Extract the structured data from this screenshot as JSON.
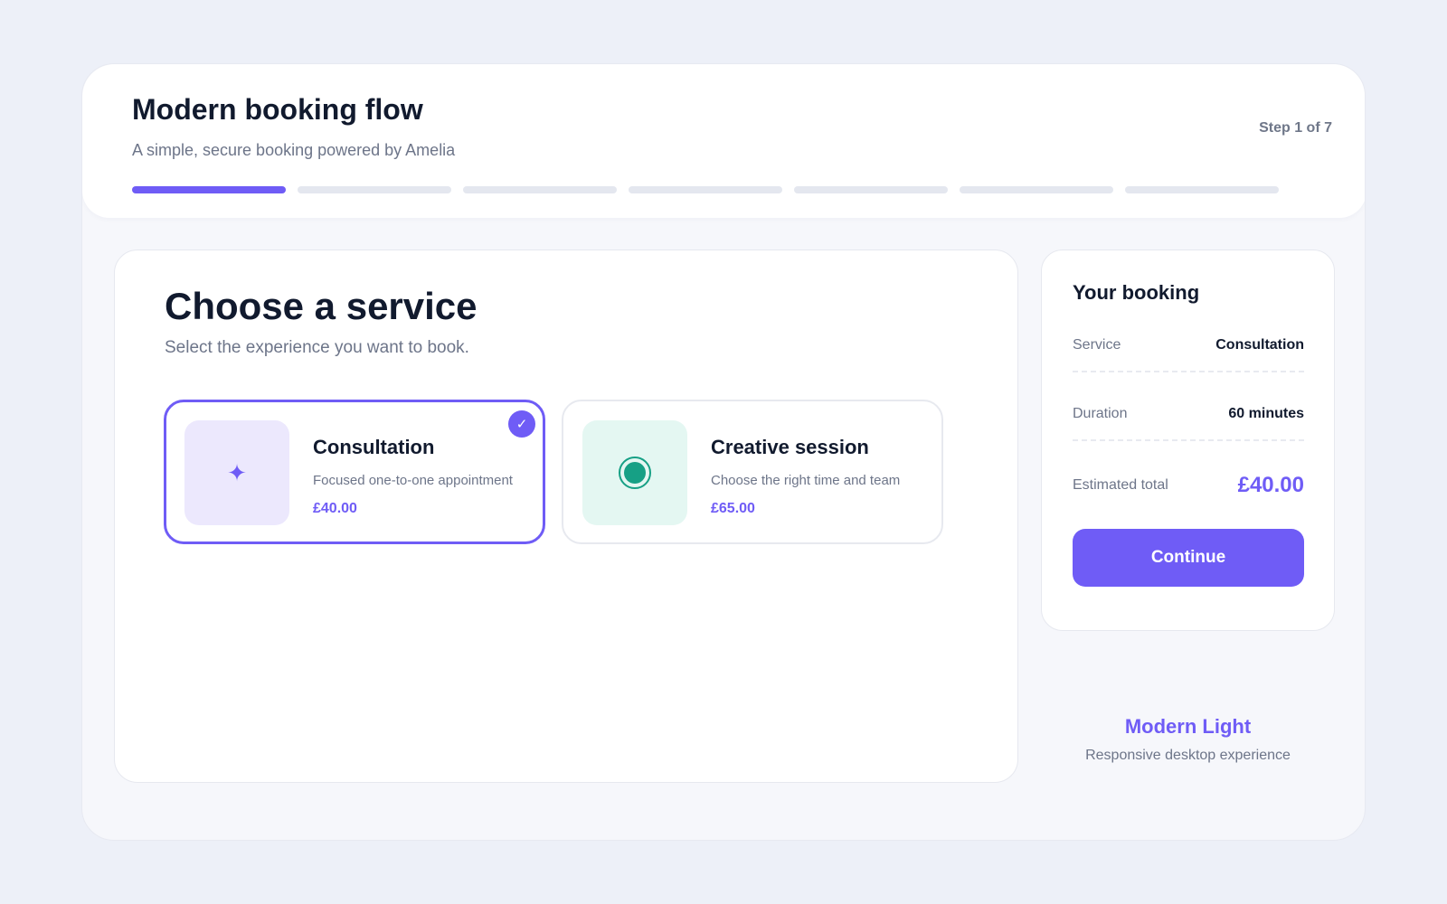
{
  "header": {
    "title": "Modern booking flow",
    "subtitle": "A simple, secure booking powered by Amelia",
    "step_label": "Step 1 of 7",
    "progress": {
      "current_step": 1,
      "total_steps": 7
    }
  },
  "main": {
    "title": "Choose a service",
    "subtitle": "Select the experience you want to book.",
    "services": [
      {
        "name": "Consultation",
        "description": "Focused one-to-one appointment",
        "price": "£40.00",
        "icon": "sparkle-icon",
        "icon_glyph": "✦",
        "selected": true,
        "check_glyph": "✓"
      },
      {
        "name": "Creative session",
        "description": "Choose the right time and team",
        "price": "£65.00",
        "icon": "target-icon",
        "selected": false
      }
    ]
  },
  "summary": {
    "title": "Your booking",
    "service_label": "Service",
    "service_value": "Consultation",
    "duration_label": "Duration",
    "duration_value": "60 minutes",
    "total_label": "Estimated total",
    "total_value": "£40.00",
    "continue_label": "Continue"
  },
  "footer": {
    "theme_name": "Modern Light",
    "theme_description": "Responsive desktop experience"
  },
  "colors": {
    "accent": "#6f5cf6",
    "teal": "#16a085",
    "background": "#edf0f8",
    "text": "#111a2e",
    "muted": "#6d7589"
  }
}
